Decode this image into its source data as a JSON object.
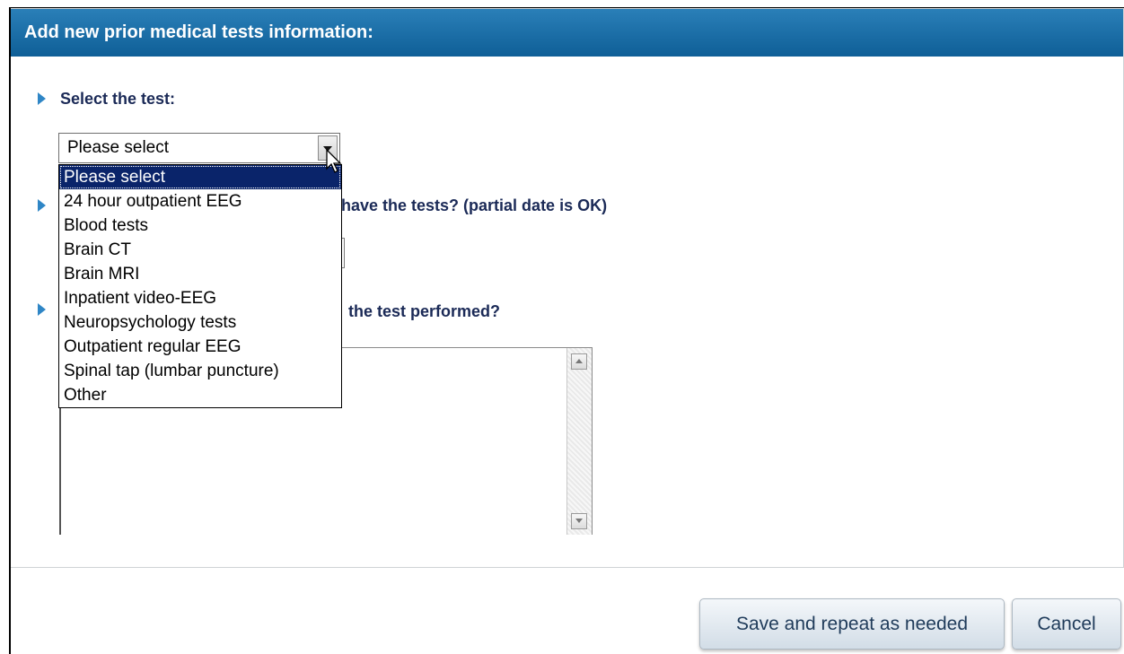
{
  "header": {
    "title": "Add new prior medical tests information:"
  },
  "questions": {
    "select_test": "Select the test:",
    "when_tests": "have the tests? (partial date is OK)",
    "where_performed": "the test performed?"
  },
  "test_select": {
    "value": "Please select",
    "options": [
      "Please select",
      "24 hour outpatient EEG",
      "Blood tests",
      "Brain CT",
      "Brain MRI",
      "Inpatient video-EEG",
      "Neuropsychology tests",
      "Outpatient regular EEG",
      "Spinal tap (lumbar puncture)",
      "Other"
    ],
    "selected_index": 0
  },
  "buttons": {
    "save": "Save and repeat as needed",
    "cancel": "Cancel"
  },
  "colors": {
    "header_bg": "#1a6ea8",
    "accent": "#2f86c6",
    "selected_option_bg": "#0a246a"
  }
}
